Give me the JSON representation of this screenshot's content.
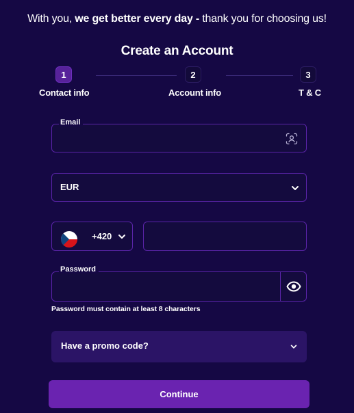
{
  "tagline": {
    "prefix": "With you, ",
    "bold": "we get better every day -",
    "suffix": " thank you for choosing us!"
  },
  "title": "Create an Account",
  "steps": [
    {
      "number": "1",
      "label": "Contact info",
      "active": true
    },
    {
      "number": "2",
      "label": "Account info",
      "active": false
    },
    {
      "number": "3",
      "label": "T & C",
      "active": false
    }
  ],
  "email": {
    "label": "Email",
    "value": "",
    "icon": "face-scan-icon"
  },
  "currency": {
    "selected": "EUR",
    "icon": "chevron-down-icon"
  },
  "phone": {
    "country_flag": "czech-flag-icon",
    "dial_code": "+420",
    "number_value": ""
  },
  "password": {
    "label": "Password",
    "value": "",
    "toggle_icon": "eye-icon",
    "hint": "Password must contain at least 8 characters"
  },
  "promo": {
    "label": "Have a promo code?"
  },
  "continue_label": "Continue",
  "colors": {
    "background": "#150844",
    "accent": "#6a23b0",
    "field_border": "#5a24a8",
    "promo_bg": "#2b1466"
  }
}
